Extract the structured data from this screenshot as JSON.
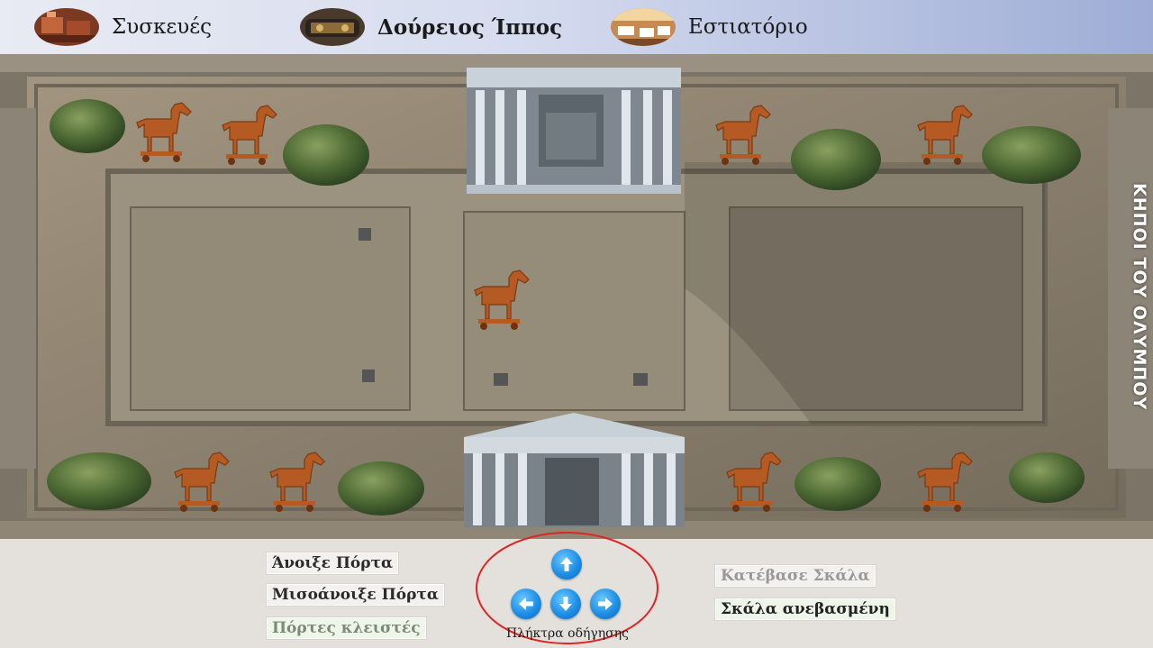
{
  "nav": {
    "items": [
      {
        "label": "Συσκευές",
        "icon": "appliances-thumbnail",
        "active": false
      },
      {
        "label": "Δούρειος Ίππος",
        "icon": "trojan-horse-thumbnail",
        "active": true
      },
      {
        "label": "Εστιατόριο",
        "icon": "restaurant-thumbnail",
        "active": false
      }
    ]
  },
  "map": {
    "garden_title": "ΚΗΠΟΙ ΤΟΥ ΟΛΥΜΠΟΥ",
    "horse_count": 9,
    "horse_icon": "trojan-horse-icon",
    "horse_color": "#b45a22"
  },
  "controls": {
    "open_door": "Άνοιξε Πόρτα",
    "half_open_door": "Μισοάνοιξε Πόρτα",
    "doors_closed": "Πόρτες κλειστές",
    "lower_ladder": "Κατέβασε Σκάλα",
    "ladder_raised": "Σκάλα ανεβασμένη",
    "dpad_label": "Πλήκτρα οδήγησης",
    "dpad_highlight_color": "#e02424",
    "arrow_color": "#1d8fe6"
  }
}
